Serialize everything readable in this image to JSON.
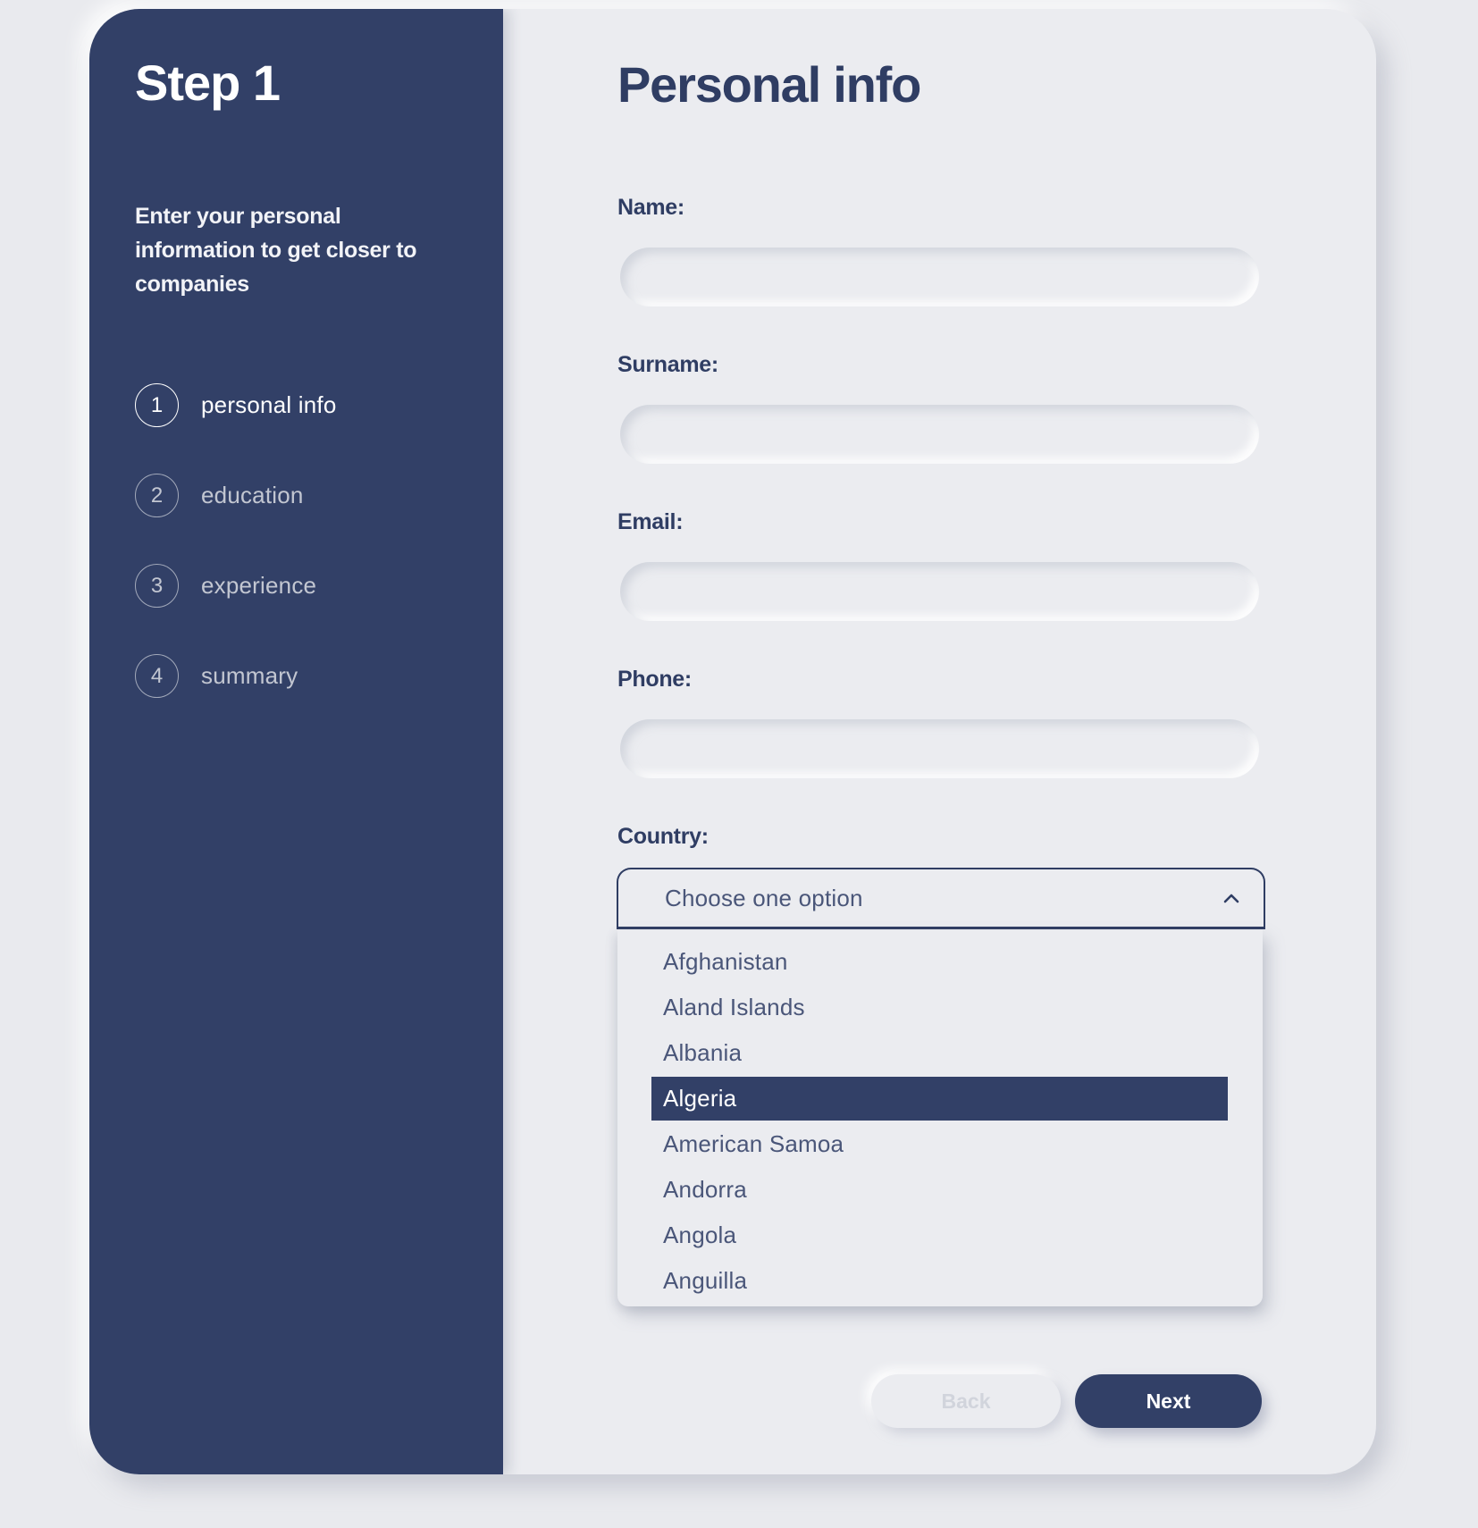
{
  "sidebar": {
    "title": "Step 1",
    "description": "Enter your personal information to get closer to companies",
    "steps": [
      {
        "number": "1",
        "label": "personal info",
        "active": true
      },
      {
        "number": "2",
        "label": "education",
        "active": false
      },
      {
        "number": "3",
        "label": "experience",
        "active": false
      },
      {
        "number": "4",
        "label": "summary",
        "active": false
      }
    ]
  },
  "main": {
    "title": "Personal info",
    "fields": {
      "name": {
        "label": "Name:",
        "value": ""
      },
      "surname": {
        "label": "Surname:",
        "value": ""
      },
      "email": {
        "label": "Email:",
        "value": ""
      },
      "phone": {
        "label": "Phone:",
        "value": ""
      }
    },
    "country": {
      "label": "Country:",
      "placeholder": "Choose one option",
      "expanded": true,
      "highlighted": "Algeria",
      "options": [
        "Afghanistan",
        "Aland Islands",
        "Albania",
        "Algeria",
        "American Samoa",
        "Andorra",
        "Angola",
        "Anguilla"
      ]
    }
  },
  "buttons": {
    "back_label": "Back",
    "next_label": "Next"
  },
  "icons": {
    "dropdown_toggle": "chevron-up-icon"
  },
  "colors": {
    "primary": "#324067",
    "background": "#ebecf0",
    "text": "#2f3d63",
    "disabled_text": "#d1d4dc"
  }
}
